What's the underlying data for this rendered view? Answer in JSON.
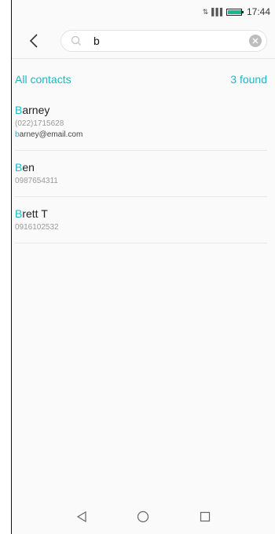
{
  "status_bar": {
    "signal": "⇅ ▐▐▐",
    "time": "17:44",
    "battery_percent": 95,
    "battery_color": "#17b890"
  },
  "search": {
    "query": "b",
    "back_icon": "chevron-left-icon",
    "search_icon": "search-icon",
    "clear_icon": "clear-icon"
  },
  "results": {
    "label": "All contacts",
    "count": "3 found",
    "accent_color": "#1ab8c4"
  },
  "contacts": [
    {
      "initial": "B",
      "rest": "arney",
      "phone": "(022)1715628",
      "email_initial": "b",
      "email_rest": "arney@email.com"
    },
    {
      "initial": "B",
      "rest": "en",
      "phone": "0987654311"
    },
    {
      "initial": "B",
      "rest": "rett T",
      "phone": "0916102532"
    }
  ],
  "navigation": {
    "back_icon": "nav-back-icon",
    "home_icon": "nav-home-icon",
    "recent_icon": "nav-recent-icon"
  }
}
